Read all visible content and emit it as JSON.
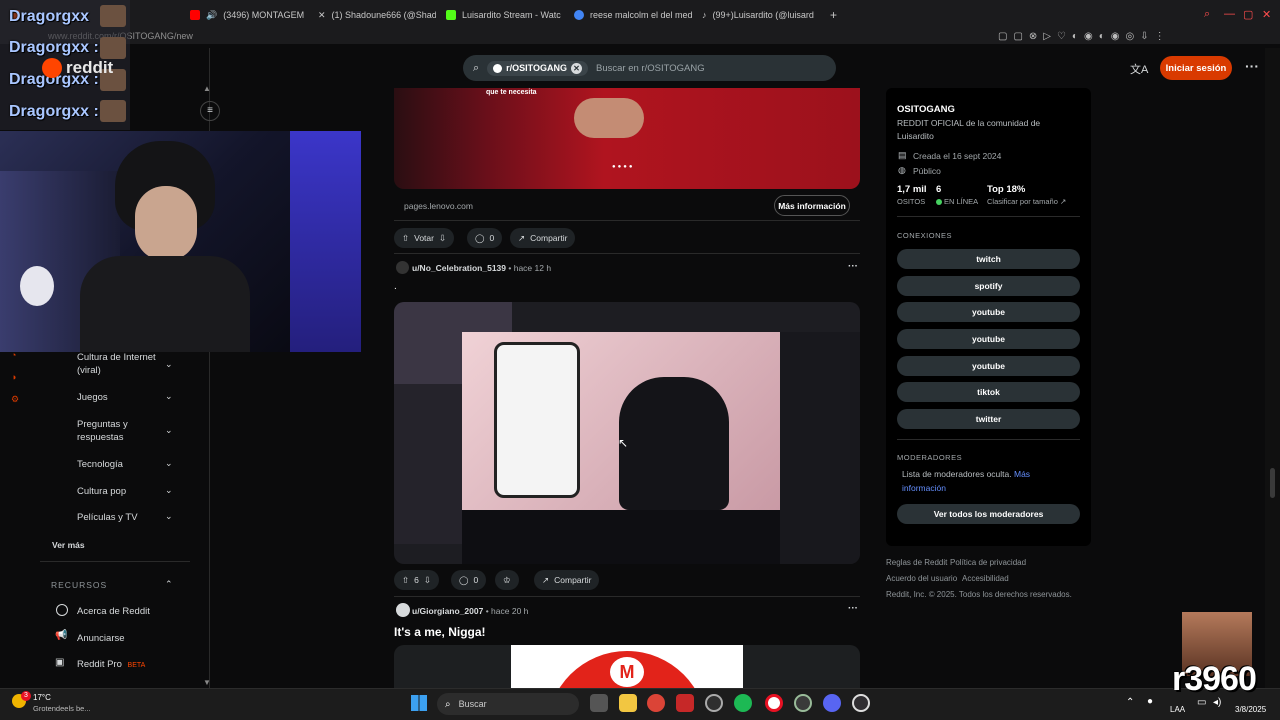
{
  "browser": {
    "tabs": [
      {
        "label": "",
        "color": "#ff4500"
      },
      {
        "label": "(3496) MONTAGEM",
        "color": "#ff0000"
      },
      {
        "label": "(1) Shadoune666 (@Shad",
        "color": "#ffffff"
      },
      {
        "label": "Luisardito Stream - Watc",
        "color": "#53fc18"
      },
      {
        "label": "reese malcolm el del med",
        "color": "#4285f4"
      },
      {
        "label": "(99+)Luisardito (@luisard",
        "color": "#ffffff"
      }
    ],
    "new_tab": "+",
    "url": "www.reddit.com/r/OSITOGANG/new"
  },
  "stream_overlay": {
    "chat_names": [
      "Dragorgxx",
      "Dragorgxx :",
      "Dragorgxx :",
      "Dragorgxx :"
    ],
    "brand": "reddit"
  },
  "header": {
    "chip_label": "r/OSITOGANG",
    "search_placeholder": "Buscar en r/OSITOGANG",
    "login_label": "Iniciar sesión"
  },
  "sidebar": {
    "topics": [
      {
        "label": "Cultura de Internet (viral)"
      },
      {
        "label": "Juegos"
      },
      {
        "label": "Preguntas y respuestas"
      },
      {
        "label": "Tecnología"
      },
      {
        "label": "Cultura pop"
      },
      {
        "label": "Películas y TV"
      }
    ],
    "see_more": "Ver más",
    "resources_title": "RECURSOS",
    "resources": [
      {
        "label": "Acerca de Reddit"
      },
      {
        "label": "Anunciarse"
      },
      {
        "label": "Reddit Pro",
        "badge": "BETA"
      }
    ]
  },
  "ad": {
    "domain": "pages.lenovo.com",
    "cta": "Más información",
    "ad_text": "que te necesita",
    "vote_label": "Votar",
    "comments": "0",
    "share": "Compartir"
  },
  "posts": [
    {
      "author": "u/No_Celebration_5139",
      "time": "hace 12 h",
      "title": ".",
      "votes": "6",
      "comments": "0",
      "share": "Compartir"
    },
    {
      "author": "u/Giorgiano_2007",
      "time": "hace 20 h",
      "title": "It's a me, Nigga!"
    }
  ],
  "community": {
    "name": "OSITOGANG",
    "description": "REDDIT OFICIAL de la comunidad de Luisardito",
    "created": "Creada el 16 sept 2024",
    "visibility": "Público",
    "members_value": "1,7 mil",
    "members_label": "OSITOS",
    "online_value": "6",
    "online_label": "EN LÍNEA",
    "rank_value": "Top 18%",
    "rank_label": "Clasificar por tamaño",
    "connections_title": "CONEXIONES",
    "connections": [
      "twitch",
      "spotify",
      "youtube",
      "youtube",
      "youtube",
      "tiktok",
      "twitter"
    ],
    "moderators_title": "MODERADORES",
    "moderators_hidden": "Lista de moderadores oculta.",
    "moderators_more": "Más información",
    "moderators_button": "Ver todos los moderadores"
  },
  "footer": {
    "rules": "Reglas de Reddit",
    "privacy": "Política de privacidad",
    "agreement": "Acuerdo del usuario",
    "accessibility": "Accesibilidad",
    "copyright": "Reddit, Inc. © 2025. Todos los derechos reservados."
  },
  "taskbar": {
    "weather_temp": "17°C",
    "weather_desc": "Grotendeels be...",
    "search_label": "Buscar",
    "lang": "LAA",
    "date": "3/8/2025",
    "overlay_number": "r3960",
    "notification_count": "3"
  },
  "colors": {
    "accent": "#d93a00",
    "online": "#46d160",
    "pill": "#2a3236"
  }
}
